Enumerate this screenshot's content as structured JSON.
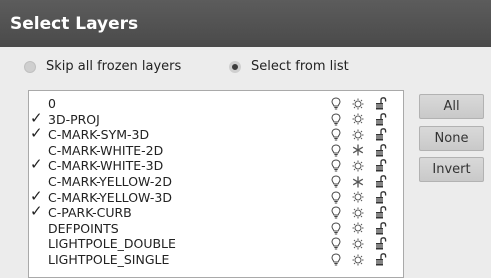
{
  "window": {
    "title": "Select Layers"
  },
  "options": {
    "skip_frozen": {
      "label": "Skip all frozen layers",
      "selected": false
    },
    "select_from_list": {
      "label": "Select from list",
      "selected": true
    }
  },
  "layers": [
    {
      "name": "0",
      "checked": false,
      "frozen": false
    },
    {
      "name": "3D-PROJ",
      "checked": true,
      "frozen": false
    },
    {
      "name": "C-MARK-SYM-3D",
      "checked": true,
      "frozen": false
    },
    {
      "name": "C-MARK-WHITE-2D",
      "checked": false,
      "frozen": true
    },
    {
      "name": "C-MARK-WHITE-3D",
      "checked": true,
      "frozen": false
    },
    {
      "name": "C-MARK-YELLOW-2D",
      "checked": false,
      "frozen": true
    },
    {
      "name": "C-MARK-YELLOW-3D",
      "checked": true,
      "frozen": false
    },
    {
      "name": "C-PARK-CURB",
      "checked": true,
      "frozen": false
    },
    {
      "name": "DEFPOINTS",
      "checked": false,
      "frozen": false
    },
    {
      "name": "LIGHTPOLE_DOUBLE",
      "checked": false,
      "frozen": false
    },
    {
      "name": "LIGHTPOLE_SINGLE",
      "checked": false,
      "frozen": false
    }
  ],
  "icons": {
    "on": "lightbulb-icon",
    "thawed": "sun-icon",
    "frozen": "snowflake-icon",
    "lock": "unlocked-icon"
  },
  "buttons": {
    "all": "All",
    "none": "None",
    "invert": "Invert"
  }
}
